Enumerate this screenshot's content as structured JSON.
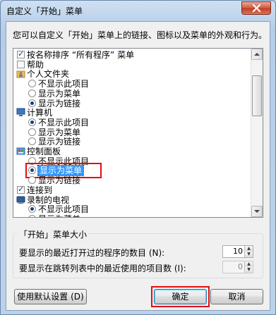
{
  "window": {
    "title": "自定义「开始」菜单"
  },
  "description": "您可以自定义「开始」菜单上的链接、图标以及菜单的外观和行为。",
  "list_items": [
    {
      "kind": "checkbox",
      "checked": true,
      "label": "按名称排序 “所有程序” 菜单"
    },
    {
      "kind": "checkbox",
      "checked": false,
      "label": "帮助"
    },
    {
      "kind": "header",
      "icon": "user-folder-icon",
      "label": "个人文件夹"
    },
    {
      "kind": "radio",
      "checked": false,
      "label": "不显示此项目"
    },
    {
      "kind": "radio",
      "checked": false,
      "label": "显示为菜单"
    },
    {
      "kind": "radio",
      "checked": true,
      "label": "显示为链接"
    },
    {
      "kind": "header",
      "icon": "computer-icon",
      "label": "计算机"
    },
    {
      "kind": "radio",
      "checked": true,
      "label": "不显示此项目"
    },
    {
      "kind": "radio",
      "checked": false,
      "label": "显示为菜单"
    },
    {
      "kind": "radio",
      "checked": false,
      "label": "显示为链接"
    },
    {
      "kind": "header",
      "icon": "control-panel-icon",
      "label": "控制面板"
    },
    {
      "kind": "radio",
      "checked": false,
      "label": "不显示此项目"
    },
    {
      "kind": "radio",
      "checked": true,
      "label": "显示为菜单",
      "selected": true
    },
    {
      "kind": "radio",
      "checked": false,
      "label": "显示为链接"
    },
    {
      "kind": "checkbox",
      "checked": true,
      "label": "连接到"
    },
    {
      "kind": "header",
      "icon": "tv-icon",
      "label": "录制的电视"
    },
    {
      "kind": "radio",
      "checked": true,
      "label": "不显示此项目"
    },
    {
      "kind": "radio",
      "checked": false,
      "label": "显示为菜单"
    }
  ],
  "size_group": {
    "title": "「开始」菜单大小",
    "recent_programs_label": "要显示的最近打开过的程序的数目 (N):",
    "recent_programs_value": "10",
    "jumplist_label": "要显示在跳转列表中的最近使用的项目数 (I):",
    "jumplist_value": "0"
  },
  "buttons": {
    "defaults": "使用默认设置 (D)",
    "ok": "确定",
    "cancel": "取消"
  },
  "highlight_color": "#e01010"
}
